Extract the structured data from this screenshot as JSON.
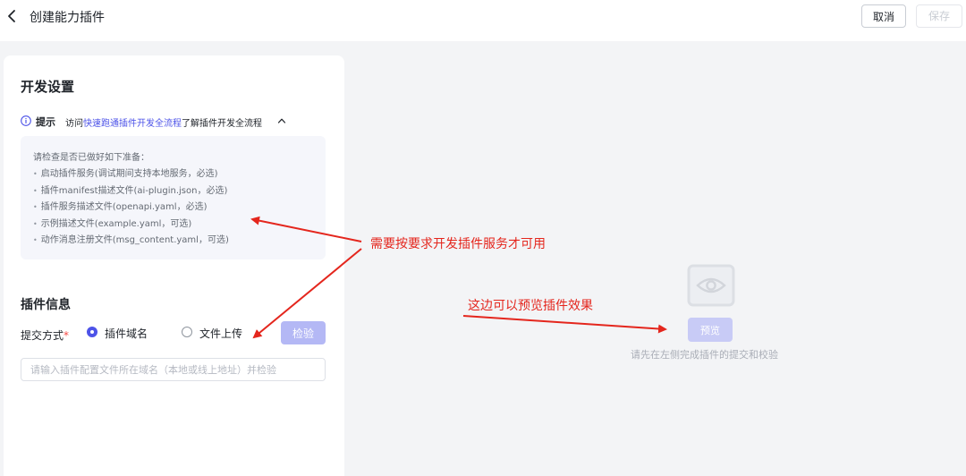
{
  "header": {
    "title": "创建能力插件",
    "cancel_label": "取消",
    "save_label": "保存"
  },
  "dev_settings": {
    "title": "开发设置",
    "tip_label": "提示",
    "tip_prefix": "访问",
    "tip_link": "快速跑通插件开发全流程",
    "tip_suffix": "了解插件开发全流程",
    "checklist_header": "请检查是否已做好如下准备：",
    "checklist": [
      "启动插件服务(调试期间支持本地服务，必选)",
      "插件manifest描述文件(ai-plugin.json，必选)",
      "插件服务描述文件(openapi.yaml，必选)",
      "示例描述文件(example.yaml，可选)",
      "动作消息注册文件(msg_content.yaml，可选)"
    ]
  },
  "plugin_info": {
    "title": "插件信息",
    "submit_label": "提交方式",
    "required_mark": "*",
    "option_domain": "插件域名",
    "option_upload": "文件上传",
    "selected": "插件域名",
    "check_label": "检验",
    "input_placeholder": "请输入插件配置文件所在域名（本地或线上地址）并检验",
    "input_value": ""
  },
  "preview": {
    "button_label": "预览",
    "hint": "请先在左侧完成插件的提交和校验"
  },
  "annotations": {
    "note1": "需要按要求开发插件服务才可用",
    "note2": "这边可以预览插件效果",
    "color": "#e4261d"
  },
  "colors": {
    "accent": "#4d53e8",
    "accent_disabled": "#b4b8f5",
    "annotation": "#e4261d"
  },
  "icons": {
    "back": "chevron-left-icon",
    "info": "info-icon",
    "collapse": "chevron-up-icon",
    "preview": "eye-icon"
  }
}
